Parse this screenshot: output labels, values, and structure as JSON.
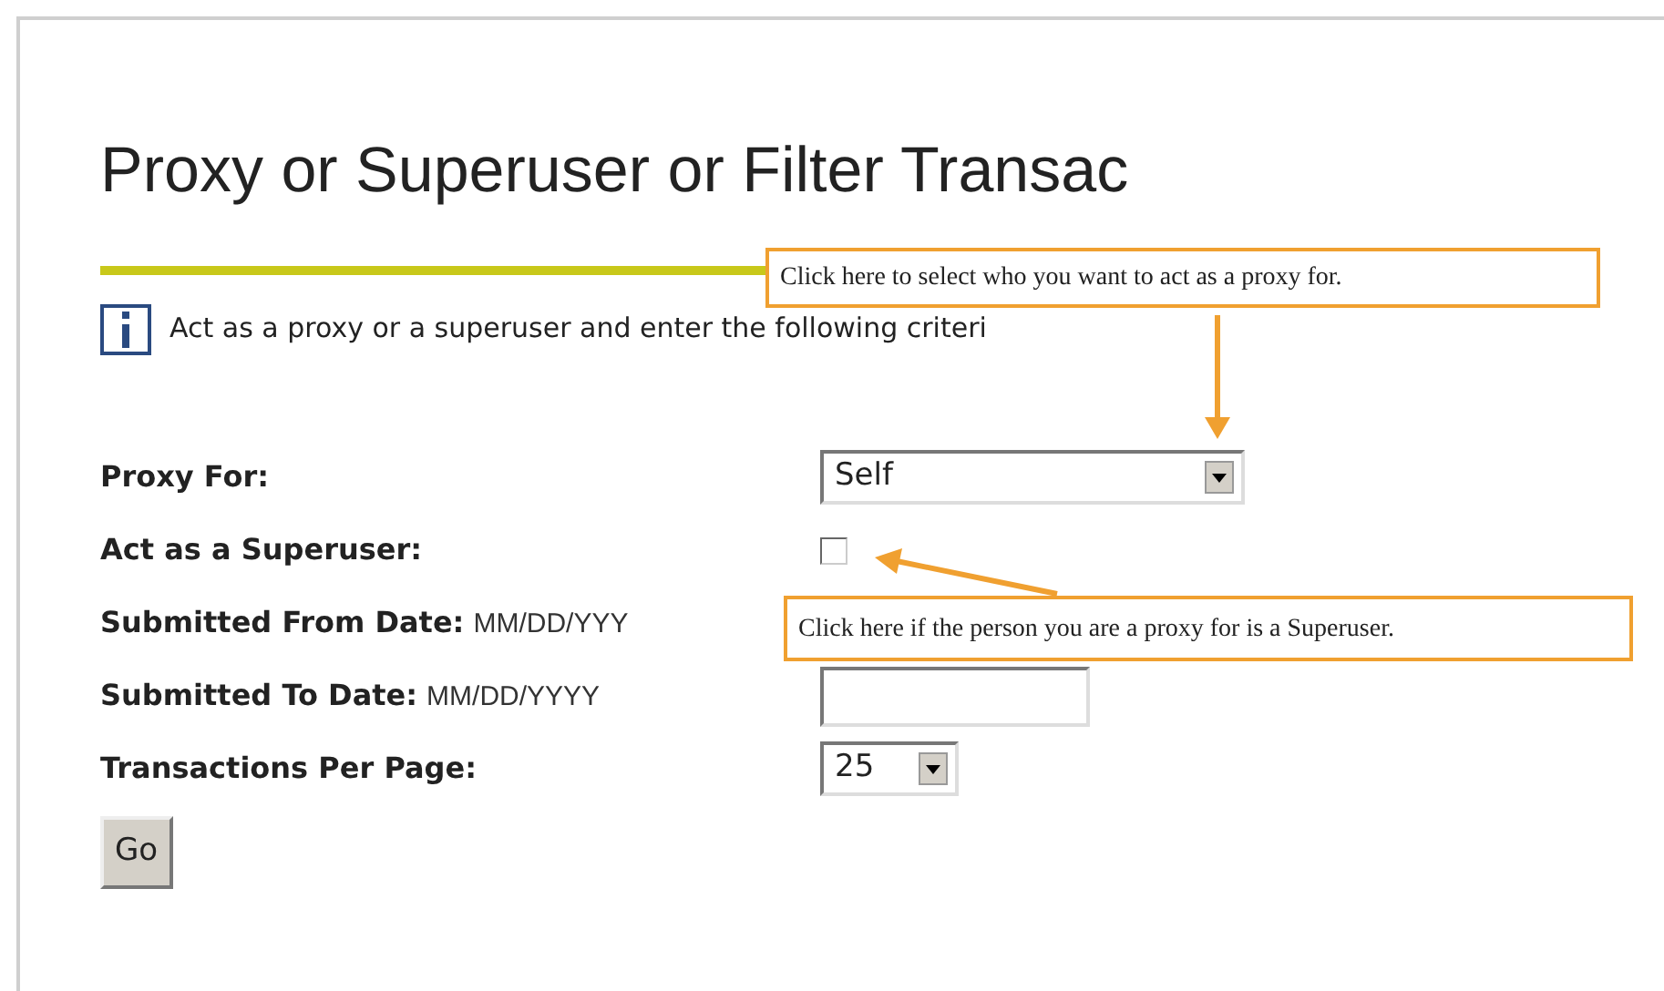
{
  "title": "Proxy or Superuser or Filter Transac",
  "intro": "Act as a proxy or a superuser and enter the following criteri",
  "fields": [
    {
      "kind": "select",
      "label": "Proxy For:",
      "value": "Self"
    },
    {
      "kind": "checkbox",
      "label": "Act as a Superuser:",
      "checked": false
    },
    {
      "kind": "date",
      "label": "Submitted From Date:",
      "hint": "MM/DD/YYY"
    },
    {
      "kind": "datebox",
      "label": "Submitted To Date:",
      "hint": "MM/DD/YYYY"
    },
    {
      "kind": "smallselect",
      "label": "Transactions Per Page:",
      "value": "25"
    }
  ],
  "go_button": "Go",
  "callouts": [
    {
      "text": "Click here to select who you want to act as a proxy for."
    },
    {
      "text": "Click here if the person you are a proxy for is a Superuser."
    }
  ]
}
